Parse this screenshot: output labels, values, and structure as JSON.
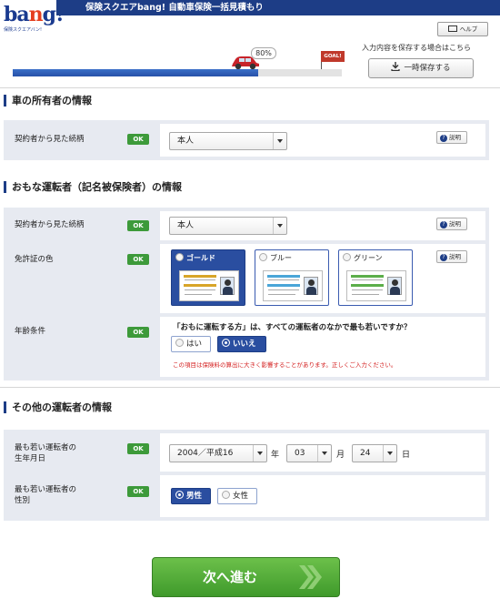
{
  "header": {
    "logo_text": "bang!",
    "logo_sub": "保険スクエアバン!",
    "title": "保険スクエアbang! 自動車保険一括見積もり",
    "help_label": "ヘルプ"
  },
  "progress": {
    "percent_label": "80%",
    "fraction": 0.8,
    "goal_label": "GOAL!",
    "save_note": "入力内容を保存する場合はこちら",
    "save_button": "一時保存する"
  },
  "section_car": {
    "title": "車の所有者の情報",
    "row_relation": {
      "label": "契約者から見た続柄",
      "ok": "OK",
      "value": "本人",
      "explain": "説明"
    }
  },
  "section_main_driver": {
    "title": "おもな運転者（記名被保険者）の情報",
    "row_relation": {
      "label": "契約者から見た続柄",
      "ok": "OK",
      "value": "本人",
      "explain": "説明"
    },
    "row_license": {
      "label": "免許証の色",
      "ok": "OK",
      "explain": "説明",
      "options": [
        {
          "label": "ゴールド",
          "selected": true,
          "band_color": "#d8a528"
        },
        {
          "label": "ブルー",
          "selected": false,
          "band_color": "#4aa6d8"
        },
        {
          "label": "グリーン",
          "selected": false,
          "band_color": "#5cae4a"
        }
      ]
    },
    "row_age": {
      "label": "年齢条件",
      "ok": "OK",
      "question": "「おもに運転する方」は、すべての運転者のなかで最も若いですか？",
      "option_yes": "はい",
      "option_no": "いいえ",
      "selected": "いいえ",
      "note": "この項目は保険料の算出に大きく影響することがあります。正しくご入力ください。"
    }
  },
  "section_other": {
    "title": "その他の運転者の情報",
    "row_birthdate": {
      "label_line1": "最も若い運転者の",
      "label_line2": "生年月日",
      "ok": "OK",
      "year": "2004／平成16",
      "year_unit": "年",
      "month": "03",
      "month_unit": "月",
      "day": "24",
      "day_unit": "日"
    },
    "row_gender": {
      "label_line1": "最も若い運転者の",
      "label_line2": "性別",
      "ok": "OK",
      "option_male": "男性",
      "option_female": "女性",
      "selected": "男性"
    }
  },
  "next_button": "次へ進む",
  "colors": {
    "brand": "#1d3d86",
    "ok_green": "#3d9a3a",
    "next_green": "#4fae35",
    "warning_red": "#d42020"
  }
}
